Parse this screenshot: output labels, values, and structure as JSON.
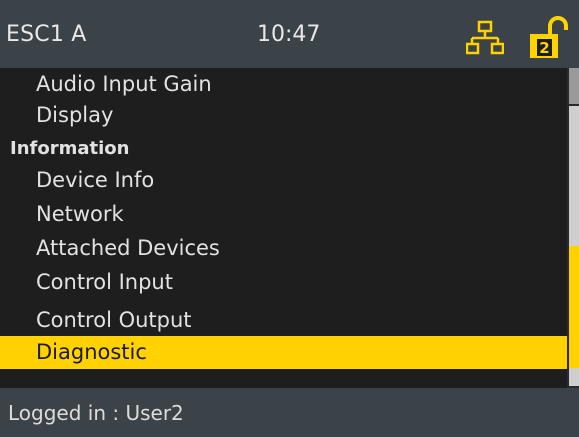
{
  "header": {
    "title": "ESC1 A",
    "time": "10:47",
    "network_icon": "network-topology-icon",
    "lock_icon": "unlocked-padlock-icon",
    "lock_level": "2",
    "accent": "#ffd200"
  },
  "menu": {
    "items": [
      {
        "label": "Audio Input Gain",
        "type": "item"
      },
      {
        "label": "Display",
        "type": "item"
      },
      {
        "label": "Information",
        "type": "header"
      },
      {
        "label": "Device Info",
        "type": "item"
      },
      {
        "label": "Network",
        "type": "item"
      },
      {
        "label": "Attached Devices",
        "type": "item"
      },
      {
        "label": "Control Input",
        "type": "item"
      },
      {
        "label": "Control Output",
        "type": "item"
      },
      {
        "label": "Diagnostic",
        "type": "item",
        "selected": true
      }
    ]
  },
  "status": {
    "text": "Logged in : User2"
  }
}
